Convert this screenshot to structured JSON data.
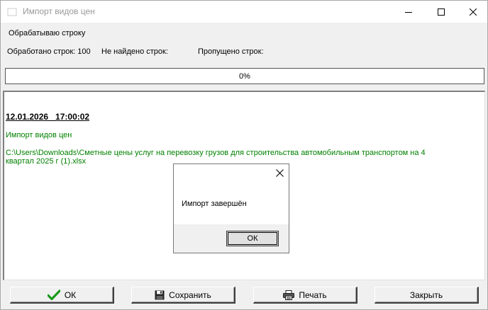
{
  "window": {
    "title": "Импорт видов цен"
  },
  "status": {
    "processing": "Обрабатываю строку",
    "processed": "Обработано строк: 100",
    "not_found": "Не найдено строк:",
    "skipped": "Пропущено строк:"
  },
  "progress": {
    "value": 0,
    "label": "0%"
  },
  "log": {
    "date": "12.01.2026   17:00:02",
    "line1": "Импорт видов цен",
    "path": "C:\\Users\\Downloads\\Сметные цены услуг на перевозку грузов для строительства автомобильным транспортом на 4 квартал 2025 г (1).xlsx"
  },
  "dialog": {
    "message": "Импорт завершён",
    "ok_label": "ОК"
  },
  "buttons": {
    "ok": "ОК",
    "save": "Сохранить",
    "print": "Печать",
    "close": "Закрыть"
  },
  "icons": {
    "ok": "check-icon",
    "save": "floppy-disk-icon",
    "print": "printer-icon"
  },
  "colors": {
    "log_green": "#008000",
    "check_green": "#1a9a1a"
  }
}
